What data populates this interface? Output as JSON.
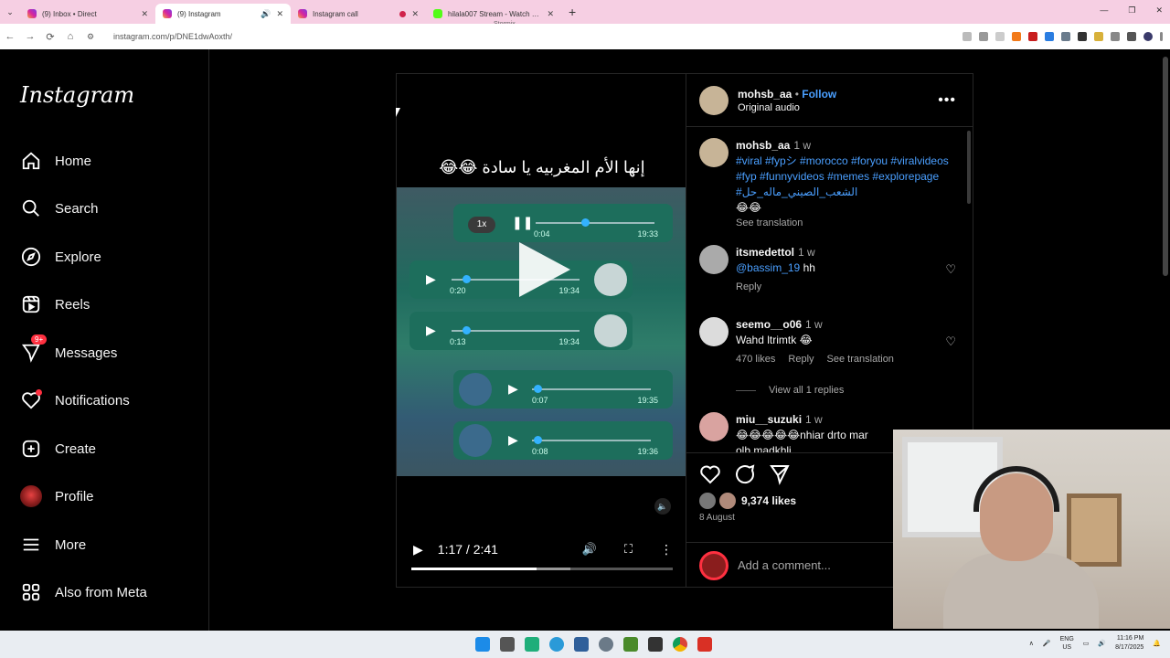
{
  "browser": {
    "tabs": [
      {
        "title": "(9) Inbox • Direct",
        "active": false
      },
      {
        "title": "(9) Instagram",
        "active": true
      },
      {
        "title": "Instagram call",
        "active": false
      },
      {
        "title": "hilala007 Stream - Watch Live o",
        "active": false
      }
    ],
    "tooltip": "Stormix",
    "url": "instagram.com/p/DNE1dwAoxth/"
  },
  "sidebar": {
    "logo": "Instagram",
    "items": [
      {
        "label": "Home",
        "icon": "home-icon"
      },
      {
        "label": "Search",
        "icon": "search-icon"
      },
      {
        "label": "Explore",
        "icon": "compass-icon"
      },
      {
        "label": "Reels",
        "icon": "reels-icon"
      },
      {
        "label": "Messages",
        "icon": "messenger-icon",
        "badge": "9+"
      },
      {
        "label": "Notifications",
        "icon": "heart-icon"
      },
      {
        "label": "Create",
        "icon": "plus-square-icon"
      },
      {
        "label": "Profile",
        "icon": "avatar-icon"
      },
      {
        "label": "More",
        "icon": "menu-icon"
      },
      {
        "label": "Also from Meta",
        "icon": "meta-icon"
      }
    ]
  },
  "video": {
    "caption": "إنها الأم المغربيه يا سادة 😂😂",
    "speed": "1x",
    "messages": [
      {
        "elapsed": "0:04",
        "time": "19:33"
      },
      {
        "elapsed": "0:20",
        "time": "19:34"
      },
      {
        "elapsed": "0:13",
        "time": "19:34"
      },
      {
        "elapsed": "0:07",
        "time": "19:35"
      },
      {
        "elapsed": "0:08",
        "time": "19:36"
      }
    ],
    "time_display": "1:17 / 2:41",
    "progress": 0.48
  },
  "post": {
    "author": "mohsb_aa",
    "follow_label": "Follow",
    "audio": "Original audio",
    "caption_time": "1 w",
    "caption_tags": "#viral #fypシ #morocco #foryou #viralvideos #fyp #funnyvideos #memes #explorepage #الشعب_الصيني_ماله_حل",
    "caption_emoji": "😂😂",
    "see_translation": "See translation",
    "comments": [
      {
        "user": "itsmedettol",
        "time": "1 w",
        "mention": "@bassim_19",
        "text": "hh",
        "reply": "Reply"
      },
      {
        "user": "seemo__o06",
        "time": "1 w",
        "text": "Wahd ltrimtk 😂",
        "likes": "470 likes",
        "reply": "Reply",
        "translate": "See translation"
      },
      {
        "user": "miu__suzuki",
        "time": "1 w",
        "text": "😂😂😂😂😂nhiar drto mar",
        "text2": "olb madkhli"
      }
    ],
    "view_replies": "View all 1 replies",
    "likes": "9,374 likes",
    "date": "8 August",
    "add_comment_placeholder": "Add a comment..."
  },
  "taskbar": {
    "lang": "ENG",
    "region": "US",
    "time": "11:16 PM",
    "date": "8/17/2025"
  }
}
